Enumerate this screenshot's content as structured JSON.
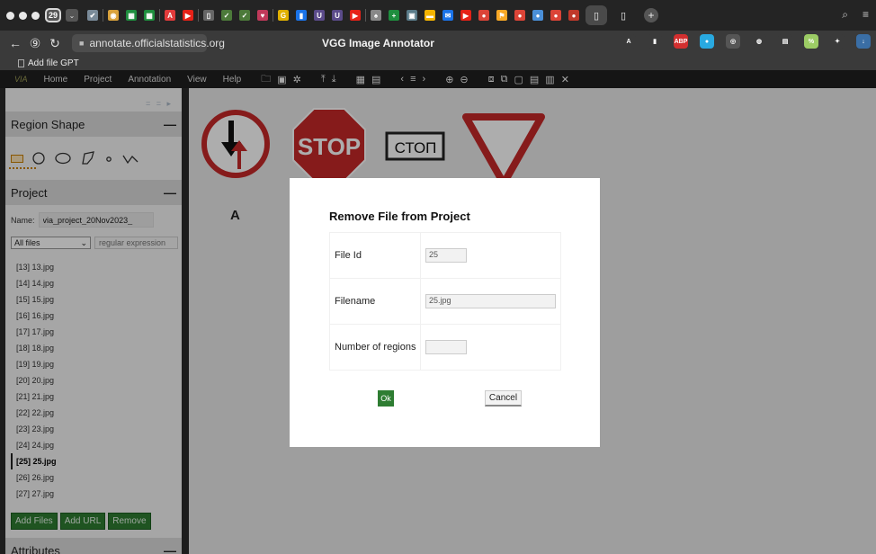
{
  "browser": {
    "tab_count": "29",
    "url": "annotate.officialstatistics.org",
    "page_title": "VGG Image Annotator",
    "bookmark": "Add file GPT",
    "tab_favicons": [
      {
        "name": "verified-icon",
        "color": "#7a8b99",
        "glyph": "✔"
      },
      {
        "name": "chrome-icon",
        "color": "#d9a23c",
        "glyph": "◉"
      },
      {
        "name": "sheets-icon",
        "color": "#1e8e3e",
        "glyph": "▦"
      },
      {
        "name": "sheets-icon",
        "color": "#1e8e3e",
        "glyph": "▦"
      },
      {
        "name": "acrobat-icon",
        "color": "#e23b3b",
        "glyph": "A"
      },
      {
        "name": "youtube-icon",
        "color": "#e62117",
        "glyph": "▶"
      },
      {
        "name": "doc-icon",
        "color": "#666666",
        "glyph": "▯"
      },
      {
        "name": "check-icon",
        "color": "#4c7a3a",
        "glyph": "✓"
      },
      {
        "name": "check-icon",
        "color": "#4c7a3a",
        "glyph": "✓"
      },
      {
        "name": "heart-icon",
        "color": "#c0395a",
        "glyph": "♥"
      },
      {
        "name": "g-icon",
        "color": "#e0b000",
        "glyph": "G"
      },
      {
        "name": "bookmark-icon",
        "color": "#1a73e8",
        "glyph": "▮"
      },
      {
        "name": "u-icon",
        "color": "#5b4b8a",
        "glyph": "U"
      },
      {
        "name": "u-icon",
        "color": "#5b4b8a",
        "glyph": "U"
      },
      {
        "name": "youtube-icon",
        "color": "#e62117",
        "glyph": "▶"
      },
      {
        "name": "hat-icon",
        "color": "#888888",
        "glyph": "♠"
      },
      {
        "name": "plus-square-icon",
        "color": "#1e8e3e",
        "glyph": "+"
      },
      {
        "name": "screen-icon",
        "color": "#5a7c8a",
        "glyph": "▣"
      },
      {
        "name": "slides-icon",
        "color": "#f4b400",
        "glyph": "▬"
      },
      {
        "name": "mail-icon",
        "color": "#1a73e8",
        "glyph": "✉"
      },
      {
        "name": "youtube-icon",
        "color": "#e62117",
        "glyph": "▶"
      },
      {
        "name": "circle-icon",
        "color": "#db4437",
        "glyph": "●"
      },
      {
        "name": "flag-icon",
        "color": "#f9a825",
        "glyph": "⚑"
      },
      {
        "name": "record-icon",
        "color": "#db4437",
        "glyph": "●"
      },
      {
        "name": "blue-icon",
        "color": "#4a90d9",
        "glyph": "●"
      },
      {
        "name": "red-icon",
        "color": "#db4437",
        "glyph": "●"
      },
      {
        "name": "badge-icon",
        "color": "#c0392b",
        "glyph": "●"
      }
    ],
    "extensions": [
      {
        "name": "translate-icon",
        "color": "#3a3a3a",
        "glyph": "A"
      },
      {
        "name": "bookmark-icon",
        "color": "#3a3a3a",
        "glyph": "▮"
      },
      {
        "name": "adblock-icon",
        "color": "#d32f2f",
        "glyph": "ABP"
      },
      {
        "name": "extension-blue-icon",
        "color": "#29a9e0",
        "glyph": "●"
      },
      {
        "name": "glasses-icon",
        "color": "#555555",
        "glyph": "◎"
      },
      {
        "name": "globe-icon",
        "color": "#3a3a3a",
        "glyph": "◍"
      },
      {
        "name": "box-icon",
        "color": "#3a3a3a",
        "glyph": "▤"
      },
      {
        "name": "discount-icon",
        "color": "#9ccc65",
        "glyph": "%"
      },
      {
        "name": "puzzle-icon",
        "color": "#3a3a3a",
        "glyph": "✦"
      },
      {
        "name": "download-icon",
        "color": "#3a6ea5",
        "glyph": "↓"
      }
    ]
  },
  "via_menu": {
    "logo": "VIA",
    "items": [
      "Home",
      "Project",
      "Annotation",
      "View",
      "Help"
    ],
    "tools": [
      "folder-icon",
      "save-icon",
      "gear-icon",
      "upload-icon",
      "download-icon",
      "grid-icon",
      "comment-icon",
      "prev-icon",
      "list-icon",
      "next-icon",
      "zoom-in-icon",
      "zoom-out-icon",
      "select-all-icon",
      "copy-icon",
      "paste-icon",
      "paste-n-icon",
      "paste-region-icon",
      "delete-icon"
    ]
  },
  "left_panel": {
    "region_shape_title": "Region Shape",
    "project_title": "Project",
    "attributes_title": "Attributes",
    "collapse_symbol": "—",
    "name_label": "Name:",
    "project_name": "via_project_20Nov2023_",
    "filter_select": "All files",
    "filter_placeholder": "regular expression",
    "files": [
      "[13] 13.jpg",
      "[14] 14.jpg",
      "[15] 15.jpg",
      "[16] 16.jpg",
      "[17] 17.jpg",
      "[18] 18.jpg",
      "[19] 19.jpg",
      "[20] 20.jpg",
      "[21] 21.jpg",
      "[22] 22.jpg",
      "[23] 23.jpg",
      "[24] 24.jpg",
      "[25] 25.jpg",
      "[26] 26.jpg",
      "[27] 27.jpg"
    ],
    "active_file_index": 12,
    "buttons": {
      "add_files": "Add Files",
      "add_url": "Add URL",
      "remove": "Remove"
    }
  },
  "canvas": {
    "stop_text": "STOP",
    "stop_cyrillic": "СТОП",
    "label_a": "A"
  },
  "modal": {
    "title": "Remove File from Project",
    "rows": [
      {
        "label": "File Id",
        "value": "25"
      },
      {
        "label": "Filename",
        "value": "25.jpg"
      },
      {
        "label": "Number of regions",
        "value": ""
      }
    ],
    "ok": "Ok",
    "cancel": "Cancel"
  },
  "colors": {
    "accent_green": "#2e7d32",
    "sign_red": "#c62828"
  }
}
